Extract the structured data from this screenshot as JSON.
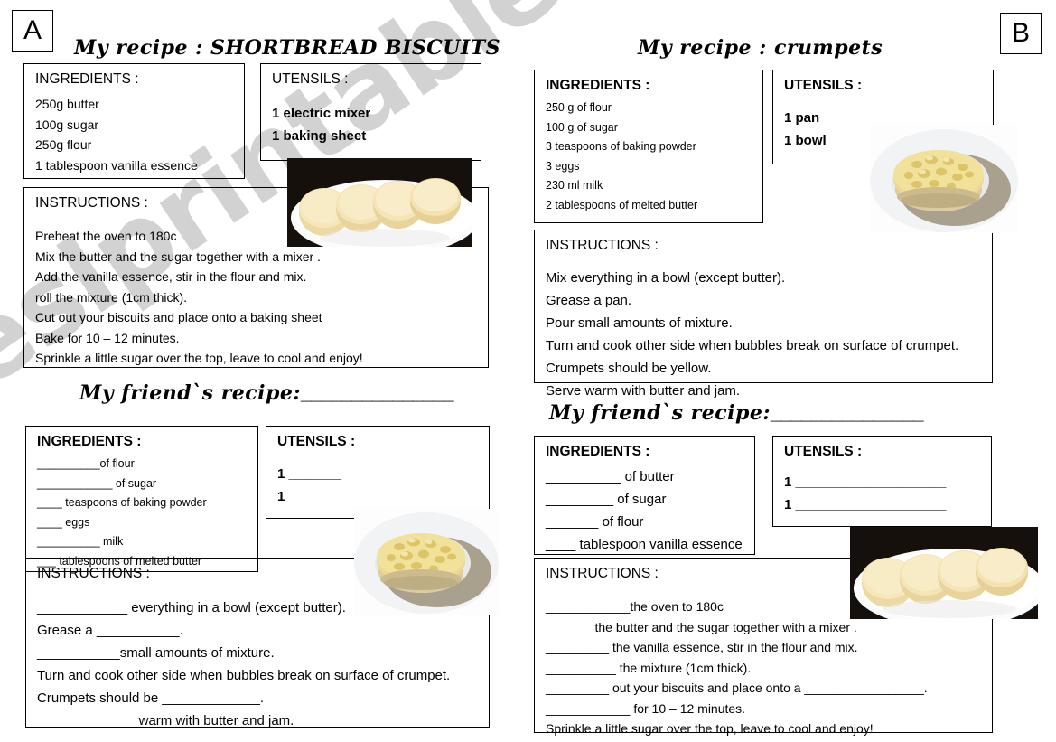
{
  "watermark": {
    "text": "eslprintables.com"
  },
  "badges": {
    "left": "A",
    "right": "B"
  },
  "labels": {
    "ingredients": "INGREDIENTS :",
    "utensils": "UTENSILS :",
    "instructions": "INSTRUCTIONS :"
  },
  "panel_a": {
    "title": "My recipe : SHORTBREAD BISCUITS",
    "ingredients": [
      "250g  butter",
      "100g  sugar",
      "250g flour",
      "1 tablespoon vanilla essence"
    ],
    "utensils": [
      "1 electric mixer",
      "1 baking sheet"
    ],
    "instructions": [
      "Preheat the oven to 180c",
      "Mix the butter and the sugar together with a mixer .",
      "Add the vanilla essence, stir in the flour and mix.",
      "roll the mixture (1cm thick).",
      "Cut out your biscuits and place onto a baking sheet",
      "Bake for 10 – 12 minutes.",
      "Sprinkle a little sugar over the top, leave to cool and enjoy!"
    ],
    "photo": "shortbread-biscuits-photo"
  },
  "panel_b": {
    "title": "My recipe : crumpets",
    "ingredients": [
      "250 g of  flour",
      "100 g of sugar",
      "3 teaspoons of baking powder",
      "3 eggs",
      "230 ml milk",
      "2 tablespoons of melted butter"
    ],
    "utensils": [
      "1 pan",
      "1 bowl"
    ],
    "instructions": [
      "Mix everything in a bowl (except butter).",
      "Grease a pan.",
      "Pour small amounts of mixture.",
      "Turn and cook other side when bubbles break on surface of crumpet.",
      "Crumpets should be yellow.",
      "Serve warm with butter and jam."
    ],
    "photo": "crumpet-photo"
  },
  "panel_c": {
    "title": "My friend`s recipe:",
    "title_blank": "_______________",
    "ingredients": [
      "__________of  flour",
      "____________ of sugar",
      "____  teaspoons of baking powder",
      "____  eggs",
      "__________ milk",
      "___ tablespoons of melted butter"
    ],
    "utensils": [
      "1 _______",
      "1 _______"
    ],
    "instructions": [
      "____________ everything in a bowl (except butter).",
      "Grease a ___________.",
      "___________small amounts of mixture.",
      "Turn and cook other side when bubbles break on surface of crumpet.",
      "Crumpets should be _____________.",
      "_____________ warm with butter and jam."
    ],
    "photo": "crumpet-photo"
  },
  "panel_d": {
    "title": "My friend`s recipe:",
    "title_blank": "_______________",
    "ingredients": [
      "__________  of  butter",
      "_________ of  sugar",
      "_______ of flour",
      "____  tablespoon vanilla essence"
    ],
    "utensils": [
      "1 ____________________",
      "1 ____________________"
    ],
    "instructions": [
      "____________the oven to 180c",
      "_______the butter and the sugar together with a mixer .",
      "_________ the vanilla essence, stir in the flour and mix.",
      "__________ the mixture (1cm thick).",
      "_________ out your biscuits and place onto a _________________.",
      "____________ for 10 – 12 minutes.",
      "Sprinkle a little sugar over the top, leave to cool and enjoy!"
    ],
    "photo": "shortbread-biscuits-photo"
  }
}
